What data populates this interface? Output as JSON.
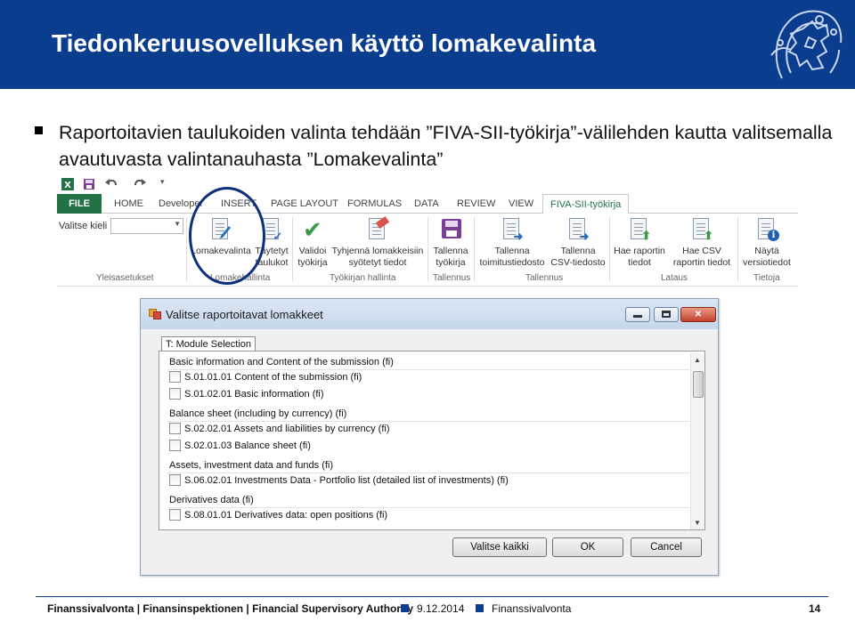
{
  "slide": {
    "title": "Tiedonkeruusovelluksen käyttö  lomakevalinta",
    "bullet": "Raportoitavien taulukoiden valinta tehdään ”FIVA-SII-työkirja”-välilehden kautta valitsemalla avautuvasta valintanauhasta ”Lomakevalinta”"
  },
  "excel": {
    "tabs": [
      "FILE",
      "HOME",
      "Developer",
      "INSERT",
      "PAGE LAYOUT",
      "FORMULAS",
      "DATA",
      "REVIEW",
      "VIEW",
      "FIVA-SII-työkirja"
    ],
    "language_label": "Valitse kieli",
    "language_value": "",
    "buttons": [
      {
        "line1": "Lomakevalinta",
        "line2": ""
      },
      {
        "line1": "Täytetyt",
        "line2": "taulukot"
      },
      {
        "line1": "Validoi",
        "line2": "työkirja"
      },
      {
        "line1": "Tyhjennä lomakkeisiin",
        "line2": "syötetyt tiedot"
      },
      {
        "line1": "Tallenna",
        "line2": "työkirja"
      },
      {
        "line1": "Tallenna",
        "line2": "toimitustiedosto"
      },
      {
        "line1": "Tallenna",
        "line2": "CSV-tiedosto"
      },
      {
        "line1": "Hae raportin",
        "line2": "tiedot"
      },
      {
        "line1": "Hae CSV",
        "line2": "raportin tiedot"
      },
      {
        "line1": "Näytä",
        "line2": "versiotiedot"
      }
    ],
    "groups": [
      "Yleisasetukset",
      "Lomakehallinta",
      "Työkirjan hallinta",
      "Tallennus",
      "Tallennus",
      "Lataus",
      "Tietoja"
    ]
  },
  "dialog": {
    "title": "Valitse raportoitavat lomakkeet",
    "tab_label": "T: Module Selection",
    "rows": [
      {
        "kind": "header",
        "text": "Basic information and Content of the submission (fi)"
      },
      {
        "kind": "item",
        "text": "S.01.01.01 Content of the submission (fi)"
      },
      {
        "kind": "item",
        "text": "S.01.02.01 Basic information (fi)"
      },
      {
        "kind": "header",
        "text": "Balance sheet (including by currency) (fi)"
      },
      {
        "kind": "item",
        "text": "S.02.02.01 Assets and liabilities by currency (fi)"
      },
      {
        "kind": "item",
        "text": "S.02.01.03 Balance sheet (fi)"
      },
      {
        "kind": "header",
        "text": "Assets, investment data and funds (fi)"
      },
      {
        "kind": "item",
        "text": "S.06.02.01 Investments Data - Portfolio list (detailed list of investments) (fi)"
      },
      {
        "kind": "header",
        "text": "Derivatives data (fi)"
      },
      {
        "kind": "item",
        "text": "S.08.01.01 Derivatives data: open positions (fi)"
      }
    ],
    "select_all_label": "Valitse kaikki",
    "ok_label": "OK",
    "cancel_label": "Cancel",
    "close_glyph": "✕"
  },
  "footer": {
    "org": "Finanssivalvonta | Finansinspektionen | Financial Supervisory Authority",
    "date": "9.12.2014",
    "section": "Finanssivalvonta",
    "page": "14"
  },
  "colors": {
    "title_bar": "#0b3d8f",
    "excel_green": "#217346",
    "highlight_ring": "#0b2f7a"
  },
  "icons": {
    "logo": "lion-crest-logo",
    "excel_app": "excel-icon",
    "save": "save-icon",
    "undo": "undo-icon",
    "redo": "redo-icon"
  }
}
